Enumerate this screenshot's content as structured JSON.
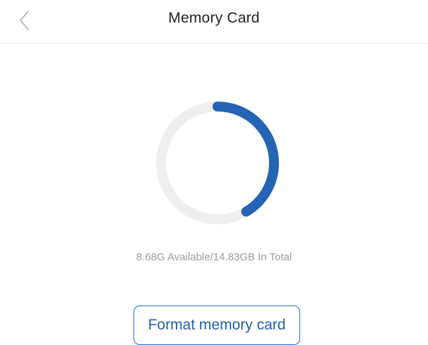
{
  "header": {
    "title": "Memory Card",
    "back_icon": "chevron-left-icon"
  },
  "storage": {
    "summary": "8.68G Available/14.83GB In Total",
    "available_gb": 8.68,
    "total_gb": 14.83,
    "used_fraction": 0.415
  },
  "actions": {
    "format_label": "Format memory card"
  },
  "colors": {
    "accent": "#2563b5",
    "ring_track": "#eeeeee",
    "button_border": "#2a6fc9",
    "secondary_text": "#9b9b9b"
  }
}
